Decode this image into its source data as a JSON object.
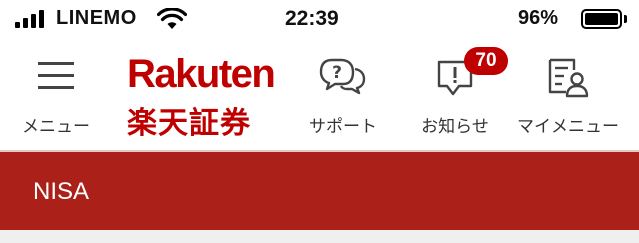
{
  "status_bar": {
    "carrier": "LINEMO",
    "time": "22:39",
    "battery_percent": "96%",
    "battery_level": 0.96,
    "signal_bars": 4
  },
  "header": {
    "menu_label": "メニュー",
    "logo_text_en": "Rakuten",
    "logo_text_ja": "楽天証券",
    "support_label": "サポート",
    "notifications_label": "お知らせ",
    "notifications_count": "70",
    "mymenu_label": "マイメニュー"
  },
  "page": {
    "title": "NISA"
  },
  "colors": {
    "brand_red": "#bf0000",
    "banner_red": "#ab2019",
    "text_white": "#ffffff"
  }
}
